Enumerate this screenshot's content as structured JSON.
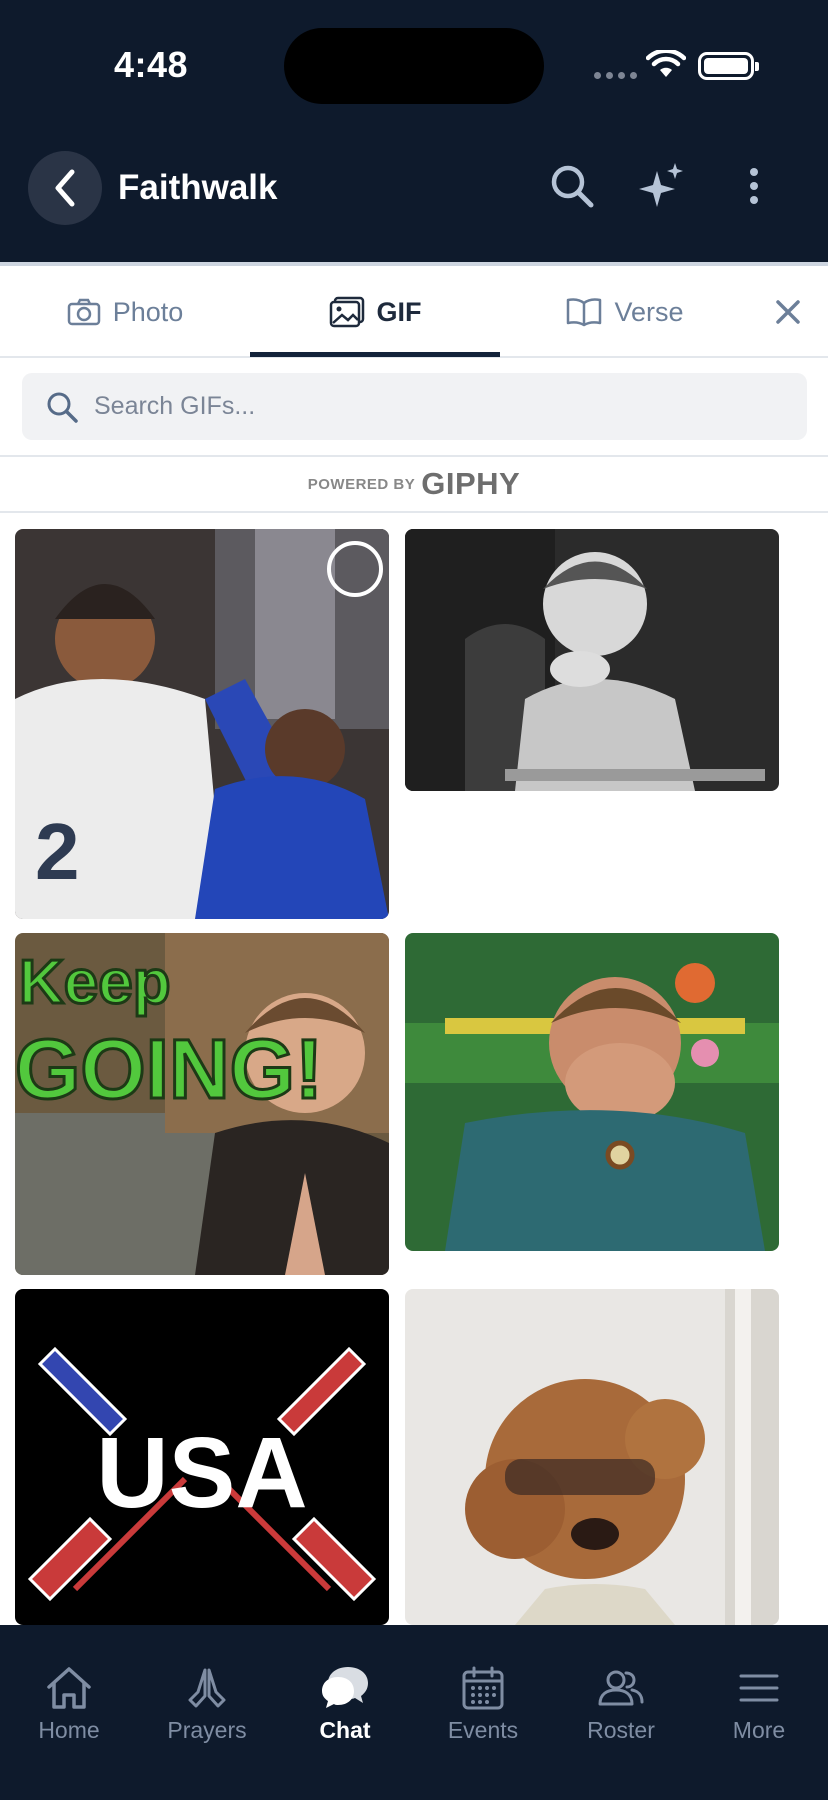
{
  "status_bar": {
    "time": "4:48"
  },
  "header": {
    "title": "Faithwalk"
  },
  "tabs": [
    {
      "label": "Photo",
      "icon": "camera-icon",
      "active": false
    },
    {
      "label": "GIF",
      "icon": "image-icon",
      "active": true
    },
    {
      "label": "Verse",
      "icon": "book-icon",
      "active": false
    }
  ],
  "search": {
    "placeholder": "Search GIFs..."
  },
  "attribution": {
    "powered_by": "POWERED BY",
    "brand": "GIPHY"
  },
  "gifs": [
    {
      "overlay_text": ""
    },
    {
      "overlay_text": ""
    },
    {
      "overlay_text_line1": "Keep",
      "overlay_text_line2": "GOING!"
    },
    {
      "overlay_text": ""
    },
    {
      "overlay_text": "USA"
    },
    {
      "overlay_text": ""
    }
  ],
  "bottom_nav": [
    {
      "label": "Home",
      "icon": "home-icon",
      "active": false
    },
    {
      "label": "Prayers",
      "icon": "praying-hands-icon",
      "active": false
    },
    {
      "label": "Chat",
      "icon": "chat-bubble-icon",
      "active": true
    },
    {
      "label": "Events",
      "icon": "calendar-icon",
      "active": false
    },
    {
      "label": "Roster",
      "icon": "people-icon",
      "active": false
    },
    {
      "label": "More",
      "icon": "menu-icon",
      "active": false
    }
  ],
  "colors": {
    "header_bg": "#0e1a2c",
    "active_tab": "#13233a",
    "inactive": "#6c7f99"
  }
}
